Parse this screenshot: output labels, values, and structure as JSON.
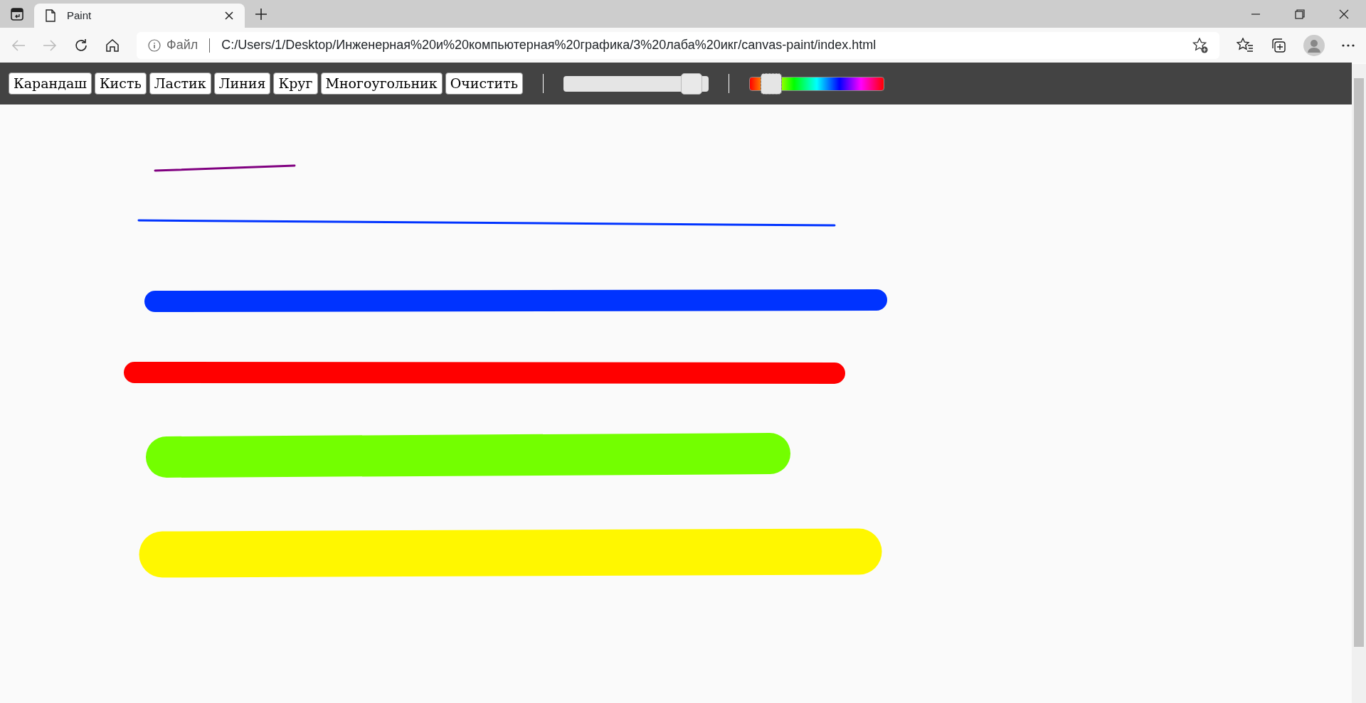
{
  "browser": {
    "tab_title": "Paint",
    "address_label": "Файл",
    "url": "C:/Users/1/Desktop/Инженерная%20и%20компьютерная%20графика/3%20лаба%20икг/canvas-paint/index.html"
  },
  "toolbar": {
    "tools": [
      {
        "label": "Карандаш"
      },
      {
        "label": "Кисть"
      },
      {
        "label": "Ластик"
      },
      {
        "label": "Линия"
      },
      {
        "label": "Круг"
      },
      {
        "label": "Многоугольник"
      },
      {
        "label": "Очистить"
      }
    ],
    "size_slider": {
      "level": 0.95
    },
    "hue_slider": {
      "level": 0.1
    }
  },
  "canvas": {
    "strokes": [
      {
        "color": "#800080"
      },
      {
        "color": "#0033ff"
      },
      {
        "color": "#0033ff"
      },
      {
        "color": "#ff0000"
      },
      {
        "color": "#73ff00"
      },
      {
        "color": "#fff700"
      }
    ]
  }
}
